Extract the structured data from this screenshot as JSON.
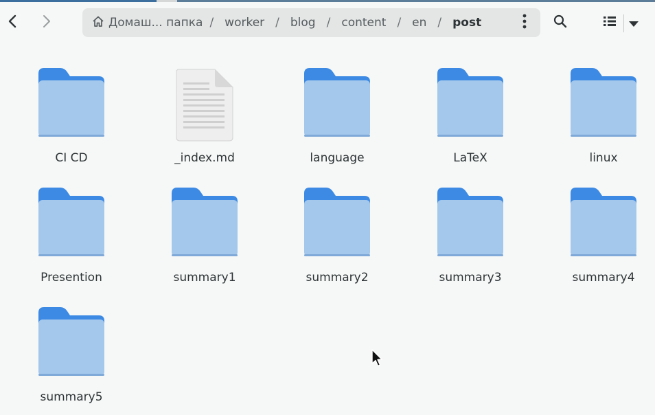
{
  "window": {
    "accent": "#3d6f9e"
  },
  "toolbar": {
    "back_icon": "chevron-left-icon",
    "forward_icon": "chevron-right-icon",
    "search_icon": "search-icon",
    "view_icon": "list-view-icon",
    "view_menu_icon": "dropdown-arrow-icon"
  },
  "path": {
    "home_icon": "home-icon",
    "crumbs": [
      "Домаш... папка",
      "worker",
      "blog",
      "content",
      "en",
      "post"
    ],
    "separator": "/",
    "menu_icon": "kebab-menu-icon"
  },
  "files": [
    {
      "name": "CI CD",
      "type": "folder"
    },
    {
      "name": "_index.md",
      "type": "document"
    },
    {
      "name": "language",
      "type": "folder"
    },
    {
      "name": "LaTeX",
      "type": "folder"
    },
    {
      "name": "linux",
      "type": "folder"
    },
    {
      "name": "Presention",
      "type": "folder"
    },
    {
      "name": "summary1",
      "type": "folder"
    },
    {
      "name": "summary2",
      "type": "folder"
    },
    {
      "name": "summary3",
      "type": "folder"
    },
    {
      "name": "summary4",
      "type": "folder"
    },
    {
      "name": "summary5",
      "type": "folder"
    }
  ],
  "colors": {
    "folder_front": "#a4c8ec",
    "folder_back": "#3d8ae4",
    "doc": "#eeeeee"
  }
}
